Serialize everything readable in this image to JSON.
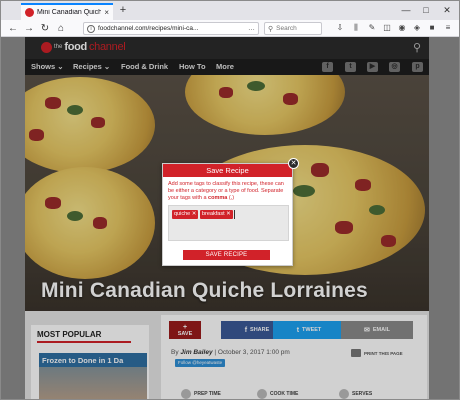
{
  "browser": {
    "tab_title": "Mini Canadian Quiche Lorraines",
    "tab_close": "×",
    "new_tab": "+",
    "url": "foodchannel.com/recipes/mini-ca...",
    "url_tail": "…",
    "search_placeholder": "Search",
    "controls": {
      "minimize": "—",
      "maximize": "□",
      "close": "✕"
    }
  },
  "site": {
    "logo_prefix": "the",
    "logo_food": "food",
    "logo_channel": "channel",
    "nav": [
      "Shows ⌄",
      "Recipes ⌄",
      "Food & Drink",
      "How To",
      "More"
    ]
  },
  "hero": {
    "title": "Mini Canadian Quiche Lorraines"
  },
  "modal": {
    "title": "Save Recipe",
    "close": "✕",
    "desc_pre": "Add some tags to classify this recipe, these can be either a category or a type of food. Separate your tags with a ",
    "desc_bold": "comma",
    "desc_post": " (,)",
    "tags": [
      "quiche ✕",
      "breakfast ✕"
    ],
    "save_label": "SAVE RECIPE"
  },
  "sidebar": {
    "heading": "MOST POPULAR",
    "card_title": "Frozen to Done in 1 Da"
  },
  "article": {
    "share": {
      "save": "SAVE",
      "facebook": "SHARE",
      "twitter": "TWEET",
      "email": "EMAIL"
    },
    "byline_by": "By ",
    "author": "Jim Bailey",
    "date": " | October 3, 2017 1:00 pm",
    "follow": "Follow @heyeatwaste",
    "print": "PRINT THIS PAGE",
    "meta": [
      "PREP TIME",
      "COOK TIME",
      "SERVES"
    ]
  },
  "colors": {
    "brand_red": "#d12229",
    "facebook": "#3b5998",
    "twitter": "#1da1f2",
    "email": "#8a8a8a"
  }
}
